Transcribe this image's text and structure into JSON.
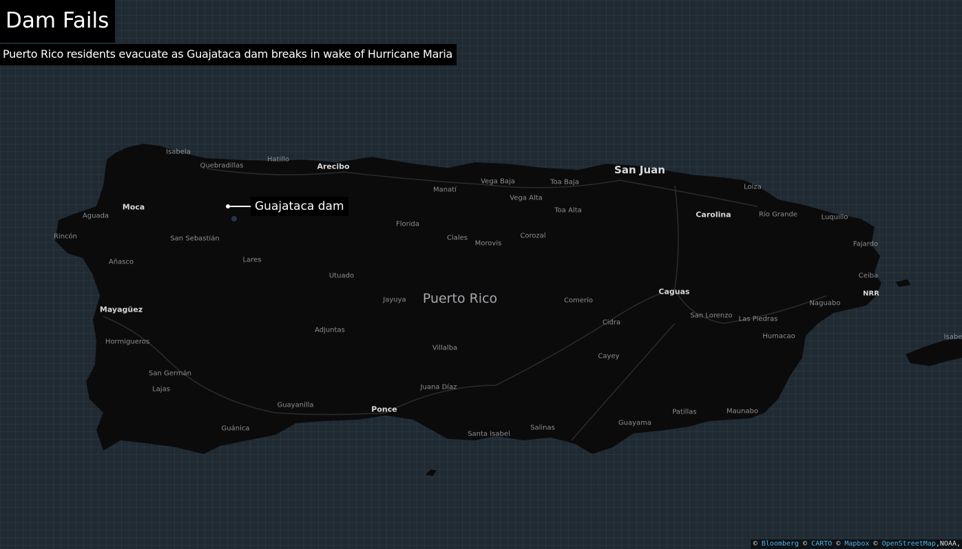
{
  "title": "Dam Fails",
  "subtitle": "Puerto Rico residents evacuate as Guajataca dam breaks in wake of Hurricane Maria",
  "callout": {
    "label": "Guajataca dam"
  },
  "region_label": "Puerto Rico",
  "cities": [
    "San Juan"
  ],
  "major_towns": [
    "Arecibo",
    "Moca",
    "Mayagüez",
    "Carolina",
    "Caguas",
    "Ponce"
  ],
  "minor_towns": [
    "Isabela",
    "Quebradillas",
    "Hatillo",
    "Aguada",
    "Rincón",
    "San Sebastián",
    "Añasco",
    "Lares",
    "Hormigueros",
    "San Germán",
    "Lajas",
    "Guánica",
    "Guayanilla",
    "Adjuntas",
    "Utuado",
    "Jayuya",
    "Villalba",
    "Juana Díaz",
    "Santa Isabel",
    "Salinas",
    "Guayama",
    "Cayey",
    "Cidra",
    "Comerío",
    "Ciales",
    "Morovis",
    "Florida",
    "Manatí",
    "Vega Baja",
    "Vega Alta",
    "Toa Baja",
    "Toa Alta",
    "Corozal",
    "Loíza",
    "Río Grande",
    "Luquillo",
    "Fajardo",
    "Ceiba",
    "NRR",
    "Naguabo",
    "Humacao",
    "Las Piedras",
    "San Lorenzo",
    "Patillas",
    "Maunabo",
    "Isabe"
  ],
  "attribution": {
    "sep": "©",
    "links": [
      "Bloomberg",
      "CARTO",
      "Mapbox",
      "OpenStreetMap"
    ],
    "tail": ",NOAA,"
  },
  "colors": {
    "ocean": "#1f2a33",
    "land": "#0b0b0c",
    "road": "#2a2a2c",
    "link": "#4fb3e8"
  }
}
